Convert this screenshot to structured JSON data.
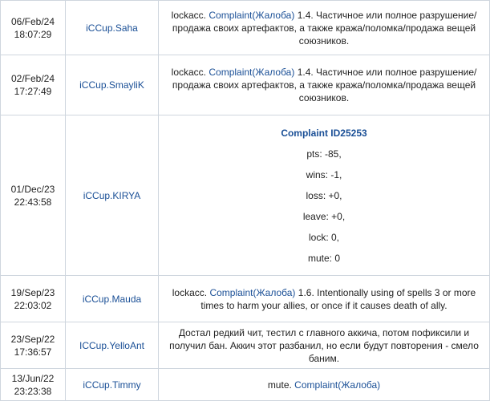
{
  "rows": [
    {
      "date": "06/Feb/24",
      "time": "18:07:29",
      "user": "iCCup.Saha",
      "reason_prefix": "lockacc. ",
      "reason_link": "Complaint(Жалоба)",
      "reason_suffix": " 1.4. Частичное или полное разрушение/продажа своих артефактов, а также кража/поломка/продажа вещей союзников."
    },
    {
      "date": "02/Feb/24",
      "time": "17:27:49",
      "user": "iCCup.SmayliK",
      "reason_prefix": "lockacc. ",
      "reason_link": "Complaint(Жалоба)",
      "reason_suffix": " 1.4. Частичное или полное разрушение/продажа своих артефактов, а также кража/поломка/продажа вещей союзников."
    },
    {
      "date": "01/Dec/23",
      "time": "22:43:58",
      "user": "iCCup.KIRYA",
      "complaint_title": "Complaint ID25253",
      "stats": [
        "pts: -85,",
        "wins: -1,",
        "loss: +0,",
        "leave: +0,",
        "lock: 0,",
        "mute: 0"
      ]
    },
    {
      "date": "19/Sep/23",
      "time": "22:03:02",
      "user": "iCCup.Mauda",
      "reason_prefix": "lockacc. ",
      "reason_link": "Complaint(Жалоба)",
      "reason_suffix": " 1.6. Intentionally using of spells 3 or more times to harm your allies, or once if it causes death of ally."
    },
    {
      "date": "23/Sep/22",
      "time": "17:36:57",
      "user": "ICCup.YelloAnt",
      "reason_text": "Достал редкий чит, тестил с главного аккича, потом пофиксили и получил бан. Аккич этот разбанил, но если будут повторения - смело баним."
    },
    {
      "date": "13/Jun/22",
      "time": "23:23:38",
      "user": "iCCup.Timmy",
      "reason_prefix": "mute. ",
      "reason_link": "Complaint(Жалоба)",
      "reason_suffix": ""
    }
  ]
}
